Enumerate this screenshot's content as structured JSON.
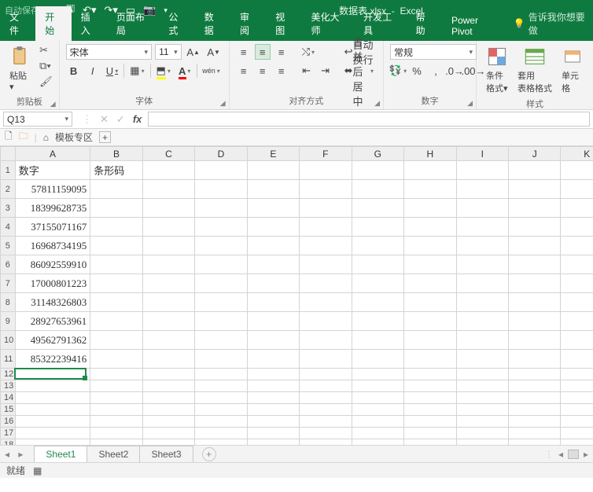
{
  "titlebar": {
    "autosave": "自动保存",
    "doc_title": "数据表.xlsx",
    "app_name": "Excel"
  },
  "tabs": {
    "file": "文件",
    "home": "开始",
    "insert": "插入",
    "layout": "页面布局",
    "formulas": "公式",
    "data": "数据",
    "review": "审阅",
    "view": "视图",
    "beautify": "美化大师",
    "developer": "开发工具",
    "help": "帮助",
    "powerpivot": "Power Pivot",
    "tell_me": "告诉我你想要做"
  },
  "ribbon": {
    "clipboard": {
      "paste": "粘贴",
      "label": "剪贴板"
    },
    "font": {
      "name": "宋体",
      "size": "11",
      "label": "字体",
      "pinyin": "wén"
    },
    "align": {
      "wrap": "自动换行",
      "merge": "合并后居中",
      "label": "对齐方式"
    },
    "number": {
      "format": "常规",
      "label": "数字"
    },
    "styles": {
      "cond": "条件格式",
      "table": "套用\n表格格式",
      "cell": "单元格",
      "label": "样式"
    }
  },
  "namebox": "Q13",
  "subtabs": {
    "template": "模板专区"
  },
  "columns": [
    "A",
    "B",
    "C",
    "D",
    "E",
    "F",
    "G",
    "H",
    "I",
    "J",
    "K"
  ],
  "rows": [
    {
      "n": 1,
      "a_txt": "数字",
      "b_txt": "条形码"
    },
    {
      "n": 2,
      "a_num": "57811159095"
    },
    {
      "n": 3,
      "a_num": "18399628735"
    },
    {
      "n": 4,
      "a_num": "37155071167"
    },
    {
      "n": 5,
      "a_num": "16968734195"
    },
    {
      "n": 6,
      "a_num": "86092559910"
    },
    {
      "n": 7,
      "a_num": "17000801223"
    },
    {
      "n": 8,
      "a_num": "31148326803"
    },
    {
      "n": 9,
      "a_num": "28927653961"
    },
    {
      "n": 10,
      "a_num": "49562791362"
    },
    {
      "n": 11,
      "a_num": "85322239416"
    },
    {
      "n": 12
    },
    {
      "n": 13
    },
    {
      "n": 14
    },
    {
      "n": 15
    },
    {
      "n": 16
    },
    {
      "n": 17
    },
    {
      "n": 18
    }
  ],
  "sheets": [
    "Sheet1",
    "Sheet2",
    "Sheet3"
  ],
  "status": {
    "ready": "就绪"
  }
}
